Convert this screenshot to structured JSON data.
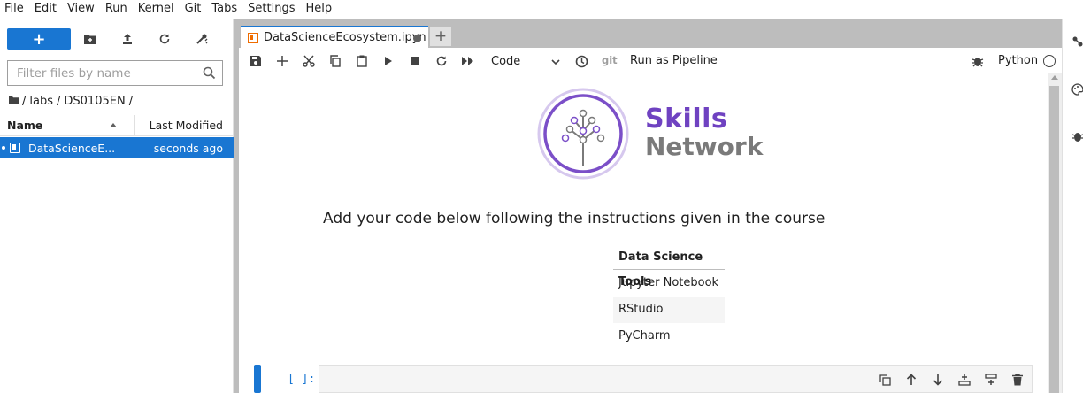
{
  "menu": [
    "File",
    "Edit",
    "View",
    "Run",
    "Kernel",
    "Git",
    "Tabs",
    "Settings",
    "Help"
  ],
  "filebrowser": {
    "new_label": "+",
    "filter_placeholder": "Filter files by name",
    "breadcrumbs": [
      "/",
      "labs",
      "/",
      "DS0105EN",
      "/"
    ],
    "columns": {
      "name": "Name",
      "modified": "Last Modified"
    },
    "files": [
      {
        "name": "DataScienceE...",
        "modified": "seconds ago"
      }
    ]
  },
  "tabs": [
    {
      "label": "DataScienceEcosystem.ipyn"
    }
  ],
  "toolbar": {
    "cell_type": "Code",
    "git_label": "git",
    "pipeline_label": "Run as Pipeline",
    "kernel_name": "Python"
  },
  "notebook": {
    "brand": {
      "line1": "Skills",
      "line2": "Network"
    },
    "instructions": "Add your code below following the instructions given in the course",
    "table": {
      "header": "Data Science Tools",
      "rows": [
        "Jupyter Notebook",
        "RStudio",
        "PyCharm"
      ]
    },
    "code_cell": {
      "prompt": "[ ]:"
    }
  },
  "colors": {
    "accent": "#1976d2",
    "brand_purple": "#6f42c1",
    "brand_gray": "#7a7a7a",
    "notebook_icon": "#ef6c00"
  }
}
